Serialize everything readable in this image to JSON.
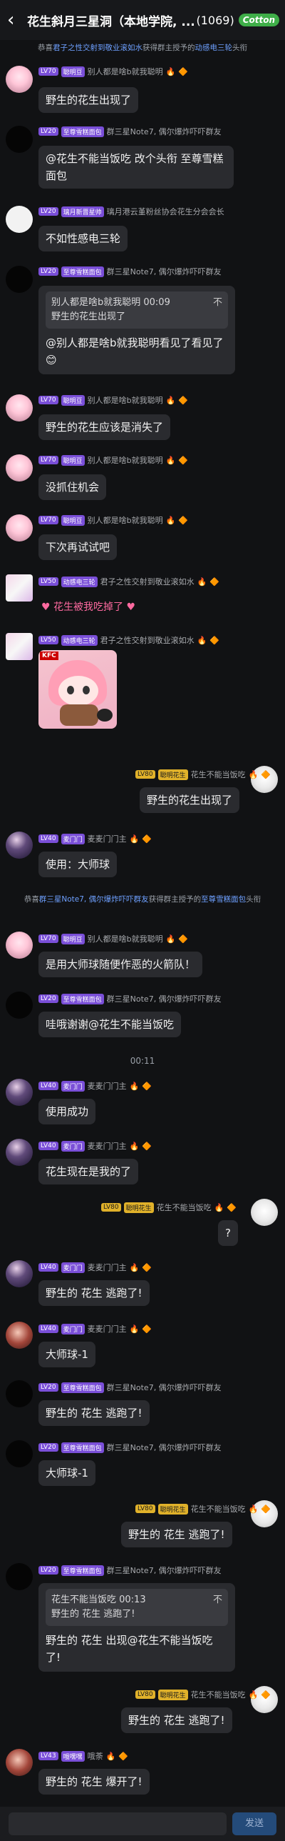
{
  "header": {
    "back_icon": "chevron-left-icon",
    "title": "花生斜月三星洞（本地学院, ...",
    "member_count": "(1069)",
    "badge": "Cotton"
  },
  "notices": {
    "n1": {
      "pre": "恭喜",
      "user": "君子之性交射到敬业滚如水",
      "mid": "获得群主授予的",
      "award": "动感电三轮",
      "post": "头衔"
    },
    "n2": {
      "pre": "恭喜",
      "user": "群三星Note7, 偶尔爆炸吓吓群友",
      "mid": "获得群主授予的",
      "award": "至尊雪糕面包",
      "post": "头衔"
    }
  },
  "time_separator": "00:11",
  "messages": [
    {
      "lv": "LV70",
      "title": "聪明豆",
      "name": "别人都是啥b就我聪明",
      "text": "野生的花生出现了"
    },
    {
      "lv": "LV20",
      "title": "至尊雪糕面包",
      "name": "群三星Note7, 偶尔爆炸吓吓群友",
      "text": "@花生不能当饭吃 改个头衔 至尊雪糕面包"
    },
    {
      "lv": "LV20",
      "title": "璃月新晋星帅",
      "name": "璃月港云堇粉丝协会花生分会会长",
      "text": "不如性感电三轮"
    },
    {
      "lv": "LV20",
      "title": "至尊雪糕面包",
      "name": "群三星Note7, 偶尔爆炸吓吓群友",
      "quote_head": "别人都是啥b就我聪明 00:09",
      "quote_body": "野生的花生出现了",
      "text": "@别人都是啥b就我聪明看见了看见了"
    },
    {
      "lv": "LV70",
      "title": "聪明豆",
      "name": "别人都是啥b就我聪明",
      "text": "野生的花生应该是消失了"
    },
    {
      "lv": "LV70",
      "title": "聪明豆",
      "name": "别人都是啥b就我聪明",
      "text": "没抓住机会"
    },
    {
      "lv": "LV70",
      "title": "聪明豆",
      "name": "别人都是啥b就我聪明",
      "text": "下次再试试吧"
    },
    {
      "lv": "LV50",
      "title": "动感电三轮",
      "name": "君子之性交射到敬业滚如水",
      "text": "花生被我吃掉了"
    },
    {
      "lv": "LV50",
      "title": "动感电三轮",
      "name": "君子之性交射到敬业滚如水",
      "sticker_tag": "KFC"
    },
    {
      "lv": "LV80",
      "title": "聪明花生",
      "name": "花生不能当饭吃",
      "text": "野生的花生出现了"
    },
    {
      "lv": "LV40",
      "title": "麦门门",
      "name": "麦麦门门主",
      "text": "使用：大师球"
    },
    {
      "lv": "LV70",
      "title": "聪明豆",
      "name": "别人都是啥b就我聪明",
      "text": "是用大师球随便作恶的火箭队！"
    },
    {
      "lv": "LV20",
      "title": "至尊雪糕面包",
      "name": "群三星Note7, 偶尔爆炸吓吓群友",
      "text": "哇哦谢谢@花生不能当饭吃"
    },
    {
      "lv": "LV40",
      "title": "麦门门",
      "name": "麦麦门门主",
      "text": "使用成功"
    },
    {
      "lv": "LV40",
      "title": "麦门门",
      "name": "麦麦门门主",
      "text": "花生现在是我的了"
    },
    {
      "lv": "LV80",
      "title": "聪明花生",
      "name": "花生不能当饭吃",
      "text": "?"
    },
    {
      "lv": "LV40",
      "title": "麦门门",
      "name": "麦麦门门主",
      "text": "野生的 花生 逃跑了!"
    },
    {
      "lv": "LV40",
      "title": "麦门门",
      "name": "麦麦门门主",
      "text": "大师球-1"
    },
    {
      "lv": "LV20",
      "title": "至尊雪糕面包",
      "name": "群三星Note7, 偶尔爆炸吓吓群友",
      "text": "野生的 花生 逃跑了!"
    },
    {
      "lv": "LV20",
      "title": "至尊雪糕面包",
      "name": "群三星Note7, 偶尔爆炸吓吓群友",
      "text": "大师球-1"
    },
    {
      "lv": "LV80",
      "title": "聪明花生",
      "name": "花生不能当饭吃",
      "text": "野生的 花生 逃跑了!"
    },
    {
      "lv": "LV20",
      "title": "至尊雪糕面包",
      "name": "群三星Note7, 偶尔爆炸吓吓群友",
      "quote_head": "花生不能当饭吃 00:13",
      "quote_body": "野生的 花生 逃跑了!",
      "text": "野生的 花生 出现@花生不能当饭吃 了!"
    },
    {
      "lv": "LV80",
      "title": "聪明花生",
      "name": "花生不能当饭吃",
      "text": "野生的 花生 逃跑了!"
    },
    {
      "lv": "LV43",
      "title": "哦嘿嘿",
      "name": "哦荼",
      "text": "野生的 花生 爆开了!"
    }
  ],
  "footer": {
    "input_placeholder": "",
    "send_label": "发送"
  },
  "colors": {
    "background": "#111214",
    "bubble": "#2a2b2f",
    "accent_blue": "#6ea0ff",
    "level_purple": "#7a4fd8",
    "level_gold": "#e0b12a"
  }
}
